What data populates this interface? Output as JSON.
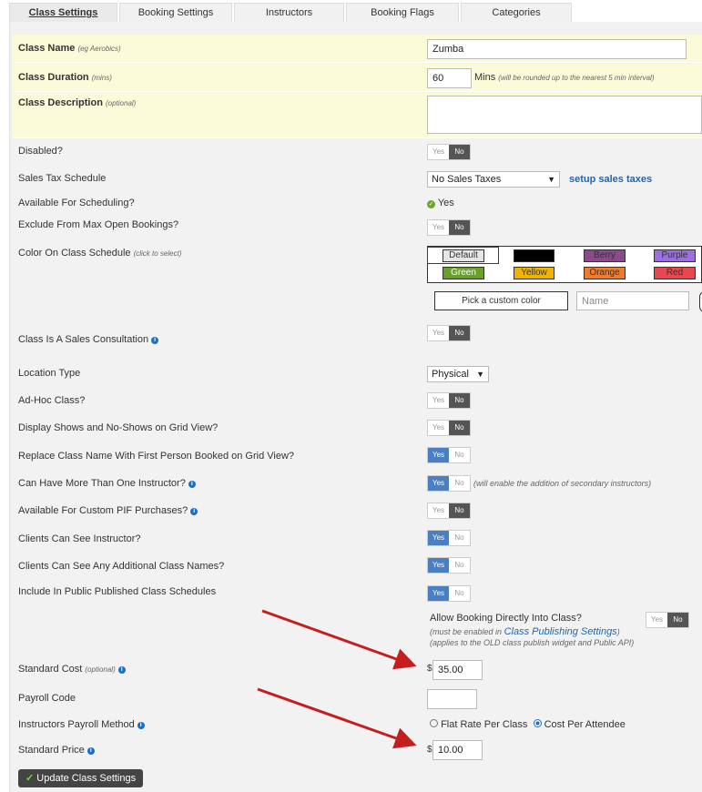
{
  "tabs": [
    "Class Settings",
    "Booking Settings",
    "Instructors",
    "Booking Flags",
    "Categories"
  ],
  "fields": {
    "class_name": {
      "label": "Class Name",
      "hint": "(eg Aerobics)",
      "value": "Zumba"
    },
    "class_duration": {
      "label": "Class Duration",
      "hint": "(mins)",
      "value": "60",
      "unit": "Mins",
      "note": "(will be rounded up to the nearest 5 min interval)"
    },
    "class_description": {
      "label": "Class Description",
      "hint": "(optional)",
      "value": ""
    },
    "disabled": {
      "label": "Disabled?"
    },
    "sales_tax": {
      "label": "Sales Tax Schedule",
      "value": "No Sales Taxes",
      "link": "setup sales taxes"
    },
    "available_scheduling": {
      "label": "Available For Scheduling?",
      "value": "Yes"
    },
    "exclude_max": {
      "label": "Exclude From Max Open Bookings?"
    },
    "color": {
      "label": "Color On Class Schedule",
      "hint": "(click to select)",
      "custom_button": "Pick a custom color",
      "name_placeholder": "Name",
      "swatches": [
        {
          "label": "Default",
          "color": "#e6e6e6"
        },
        {
          "label": "",
          "color": "#000000"
        },
        {
          "label": "Berry",
          "color": "#8a4a8c"
        },
        {
          "label": "Purple",
          "color": "#9b6fe0"
        },
        {
          "label": "Green",
          "color": "#6aa02a"
        },
        {
          "label": "Yellow",
          "color": "#f0b400"
        },
        {
          "label": "Orange",
          "color": "#f07c2a"
        },
        {
          "label": "Red",
          "color": "#e8474f"
        }
      ]
    },
    "sales_consult": {
      "label": "Class Is A Sales Consultation"
    },
    "location_type": {
      "label": "Location Type",
      "value": "Physical"
    },
    "adhoc": {
      "label": "Ad-Hoc Class?"
    },
    "shows": {
      "label": "Display Shows and No-Shows on Grid View?"
    },
    "replace_name": {
      "label": "Replace Class Name With First Person Booked on Grid View?"
    },
    "multi_instructor": {
      "label": "Can Have More Than One Instructor?",
      "note": "(will enable the addition of secondary instructors)"
    },
    "pif": {
      "label": "Available For Custom PIF Purchases?"
    },
    "see_instructor": {
      "label": "Clients Can See Instructor?"
    },
    "see_names": {
      "label": "Clients Can See Any Additional Class Names?"
    },
    "public": {
      "label": "Include In Public Published Class Schedules"
    },
    "allow_booking": {
      "label": "Allow Booking Directly Into Class?",
      "note1_prefix": "(must be enabled in ",
      "note1_link": "Class Publishing Settings",
      "note1_suffix": ")",
      "note2": "(applies to the OLD class publish widget and Public API)"
    },
    "standard_cost": {
      "label": "Standard Cost",
      "hint": "(optional)",
      "currency": "$",
      "value": "35.00"
    },
    "payroll_code": {
      "label": "Payroll Code",
      "value": ""
    },
    "payroll_method": {
      "label": "Instructors Payroll Method",
      "option1": "Flat Rate Per Class",
      "option2": "Cost Per Attendee"
    },
    "standard_price": {
      "label": "Standard Price",
      "currency": "$",
      "value": "10.00"
    }
  },
  "toggle": {
    "yes": "Yes",
    "no": "No"
  },
  "update_button": "Update Class Settings"
}
